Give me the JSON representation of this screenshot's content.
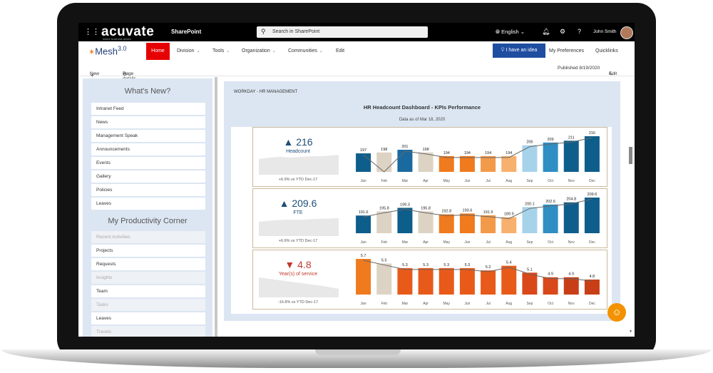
{
  "topbar": {
    "logo": "acuvate",
    "logo_tagline": "where business drives",
    "app_name": "SharePoint",
    "search_placeholder": "Search in SharePoint",
    "language": "English",
    "user_name": "John Smith"
  },
  "nav": {
    "site_name": "Mesh",
    "site_version": "3.0",
    "items": [
      "Home",
      "Division",
      "Tools",
      "Organization",
      "Communities",
      "Edit"
    ],
    "idea_button": "I have an idea",
    "preferences": "My Preferences",
    "quicklinks": "Quicklinks"
  },
  "commandbar": {
    "new": "New",
    "page_details": "Page details",
    "published": "Published 8/19/2020",
    "edit": "Edit"
  },
  "left_panel": {
    "whats_new_title": "What's New?",
    "whats_new_items": [
      "Intranet Feed",
      "News",
      "Management Speak",
      "Announcements",
      "Events",
      "Gallery",
      "Policies",
      "Leaves"
    ],
    "productivity_title": "My Productivity Corner",
    "productivity_items": [
      {
        "label": "Recent Activities",
        "sub": true
      },
      {
        "label": "Projects",
        "sub": false
      },
      {
        "label": "Requests",
        "sub": false
      },
      {
        "label": "Insights",
        "sub": true
      },
      {
        "label": "Team",
        "sub": false
      },
      {
        "label": "Tasks",
        "sub": true
      },
      {
        "label": "Leaves",
        "sub": false
      },
      {
        "label": "Travels",
        "sub": true
      }
    ]
  },
  "dashboard": {
    "breadcrumb": "WORKDAY - HR MANAGEMENT",
    "title": "HR Headcount Dashboard - KPIs Performance",
    "subtitle": "Data as of Mar 18, 2020"
  },
  "chart_data": [
    {
      "type": "bar",
      "kpi_value": "216",
      "kpi_direction": "up",
      "kpi_label": "Headcount",
      "kpi_note": "+6.9% vs YTD Dec-17",
      "categories": [
        "Jan",
        "Feb",
        "Mar",
        "Apr",
        "May",
        "Jun",
        "Jul",
        "Aug",
        "Sep",
        "Oct",
        "Nov",
        "Dec"
      ],
      "values": [
        197,
        198,
        201,
        198,
        194,
        194,
        194,
        194,
        206,
        209,
        211,
        216
      ],
      "labels": [
        "197",
        "198",
        "201",
        "198",
        "194",
        "194",
        "194",
        "194",
        "206",
        "209",
        "211",
        "216"
      ],
      "colors": [
        "#0e5e8b",
        "#ddd3c4",
        "#1a6aa0",
        "#ddd3c4",
        "#f07a1e",
        "#f07a1e",
        "#f39a4a",
        "#f7b06d",
        "#a6d3ea",
        "#2f8ec4",
        "#0e5e8b",
        "#0e5e8b"
      ],
      "line": [
        197,
        160,
        201,
        198,
        194,
        194,
        194,
        194,
        206,
        209,
        211,
        216
      ]
    },
    {
      "type": "bar",
      "kpi_value": "209.6",
      "kpi_direction": "up",
      "kpi_label": "FTE",
      "kpi_note": "+6.6% vs YTD Dec-17",
      "categories": [
        "Jan",
        "Feb",
        "Mar",
        "Apr",
        "May",
        "Jun",
        "Jul",
        "Aug",
        "Sep",
        "Oct",
        "Nov",
        "Dec"
      ],
      "values": [
        191.6,
        195.8,
        199.3,
        195.8,
        192.8,
        193.6,
        191.9,
        189.9,
        200.1,
        202.6,
        204.8,
        209.6
      ],
      "labels": [
        "191.6",
        "195.8",
        "199.3",
        "195.8",
        "192.8",
        "193.6",
        "191.9",
        "189.9",
        "200.1",
        "202.6",
        "204.8",
        "209.6"
      ],
      "colors": [
        "#0e5e8b",
        "#ddd3c4",
        "#0e5e8b",
        "#ddd3c4",
        "#f07a1e",
        "#f07a1e",
        "#f39a4a",
        "#f7b06d",
        "#a6d3ea",
        "#2f8ec4",
        "#0e5e8b",
        "#0e5e8b"
      ],
      "line": [
        191.6,
        195.8,
        199.3,
        195.8,
        192.8,
        193.6,
        191.9,
        189.9,
        200.1,
        202.6,
        204.8,
        209.6
      ]
    },
    {
      "type": "bar",
      "kpi_value": "4.8",
      "kpi_direction": "down",
      "kpi_label": "Year(s) of service",
      "kpi_note": "-16.8% vs YTD Dec-17",
      "categories": [
        "Jan",
        "Feb",
        "Mar",
        "Apr",
        "May",
        "Jun",
        "Jul",
        "Aug",
        "Sep",
        "Oct",
        "Nov",
        "Dec"
      ],
      "values": [
        5.7,
        5.5,
        5.3,
        5.3,
        5.3,
        5.3,
        5.2,
        5.4,
        5.1,
        4.9,
        4.9,
        4.8
      ],
      "labels": [
        "5.7",
        "5.5",
        "5.3",
        "5.3",
        "5.3",
        "5.3",
        "5.2",
        "5.4",
        "5.1",
        "4.9",
        "4.9",
        "4.8"
      ],
      "colors": [
        "#f07a1e",
        "#ddd3c4",
        "#e85a1a",
        "#e85a1a",
        "#e85a1a",
        "#e85a1a",
        "#e85a1a",
        "#e85a1a",
        "#d9481a",
        "#d9481a",
        "#c83f17",
        "#c83f17"
      ],
      "line": [
        5.7,
        5.5,
        5.3,
        5.3,
        5.3,
        5.3,
        5.2,
        5.4,
        5.1,
        4.9,
        4.9,
        4.8
      ]
    }
  ],
  "colors": {
    "accent_red": "#e60000",
    "idea_blue": "#1f4ea1",
    "kpi_up": "#1f4e79",
    "kpi_down": "#c0392b",
    "robot": "#f39200"
  }
}
